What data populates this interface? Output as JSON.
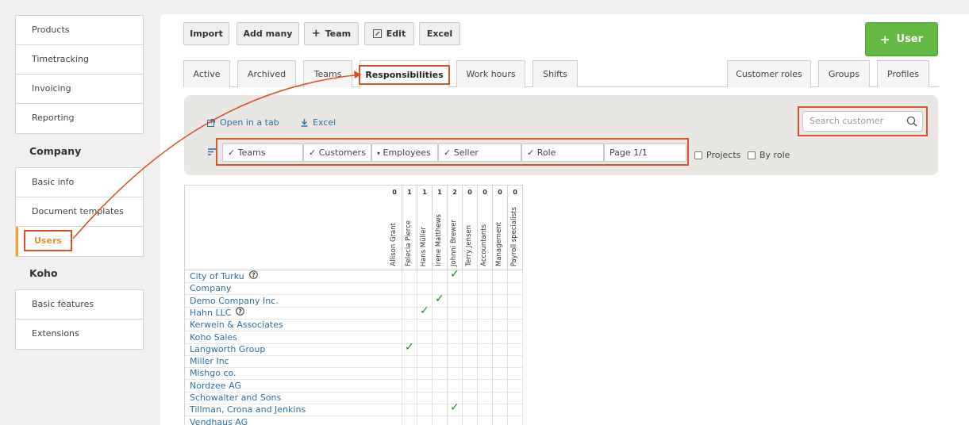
{
  "sidebar": {
    "group1": [
      "Products",
      "Timetracking",
      "Invoicing",
      "Reporting"
    ],
    "company_heading": "Company",
    "group2": [
      "Basic info",
      "Document templates",
      "Users"
    ],
    "koho_heading": "Koho",
    "group3": [
      "Basic features",
      "Extensions"
    ]
  },
  "toolbar": {
    "import": "Import",
    "add_many": "Add many",
    "team": "Team",
    "edit": "Edit",
    "excel": "Excel",
    "user": "User"
  },
  "tabs": {
    "active": "Active",
    "archived": "Archived",
    "teams": "Teams",
    "responsibilities": "Responsibilities",
    "work_hours": "Work hours",
    "shifts": "Shifts",
    "customer_roles": "Customer roles",
    "groups": "Groups",
    "profiles": "Profiles"
  },
  "filter": {
    "open_in_tab": "Open in a tab",
    "excel": "Excel",
    "search_placeholder": "Search customer",
    "teams": "✓ Teams",
    "customers": "✓ Customers",
    "employees": "Employees",
    "seller": "✓ Seller",
    "role": "✓ Role",
    "page": "Page 1/1",
    "projects": "Projects",
    "by_role": "By role"
  },
  "table": {
    "columns": [
      {
        "name": "Allison Grant",
        "count": "0"
      },
      {
        "name": "Felecia Pierce",
        "count": "1"
      },
      {
        "name": "Hans Müller",
        "count": "1"
      },
      {
        "name": "Irene Matthews",
        "count": "1"
      },
      {
        "name": "Johnni Brewer",
        "count": "2"
      },
      {
        "name": "Terry Jensen",
        "count": "0"
      },
      {
        "name": "Accountants",
        "count": "0"
      },
      {
        "name": "Management",
        "count": "0"
      },
      {
        "name": "Payroll specialists",
        "count": "0"
      }
    ],
    "rows": [
      {
        "name": "City of Turku",
        "help": true,
        "checks": [
          4
        ]
      },
      {
        "name": "Company",
        "help": false,
        "checks": []
      },
      {
        "name": "Demo Company Inc.",
        "help": false,
        "checks": [
          3
        ]
      },
      {
        "name": "Hahn LLC",
        "help": true,
        "checks": [
          2
        ]
      },
      {
        "name": "Kerwein & Associates",
        "help": false,
        "checks": []
      },
      {
        "name": "Koho Sales",
        "help": false,
        "checks": []
      },
      {
        "name": "Langworth Group",
        "help": false,
        "checks": [
          1
        ]
      },
      {
        "name": "Miller Inc",
        "help": false,
        "checks": []
      },
      {
        "name": "Mishgo co.",
        "help": false,
        "checks": []
      },
      {
        "name": "Nordzee AG",
        "help": false,
        "checks": []
      },
      {
        "name": "Schowalter and Sons",
        "help": false,
        "checks": []
      },
      {
        "name": "Tillman, Crona and Jenkins",
        "help": false,
        "checks": [
          4
        ]
      },
      {
        "name": "Vendhaus AG",
        "help": false,
        "checks": []
      }
    ]
  },
  "colors": {
    "accent": "#d8532a",
    "link": "#2e6fa3",
    "check": "#1e8a1e",
    "user_button": "#64b844"
  }
}
